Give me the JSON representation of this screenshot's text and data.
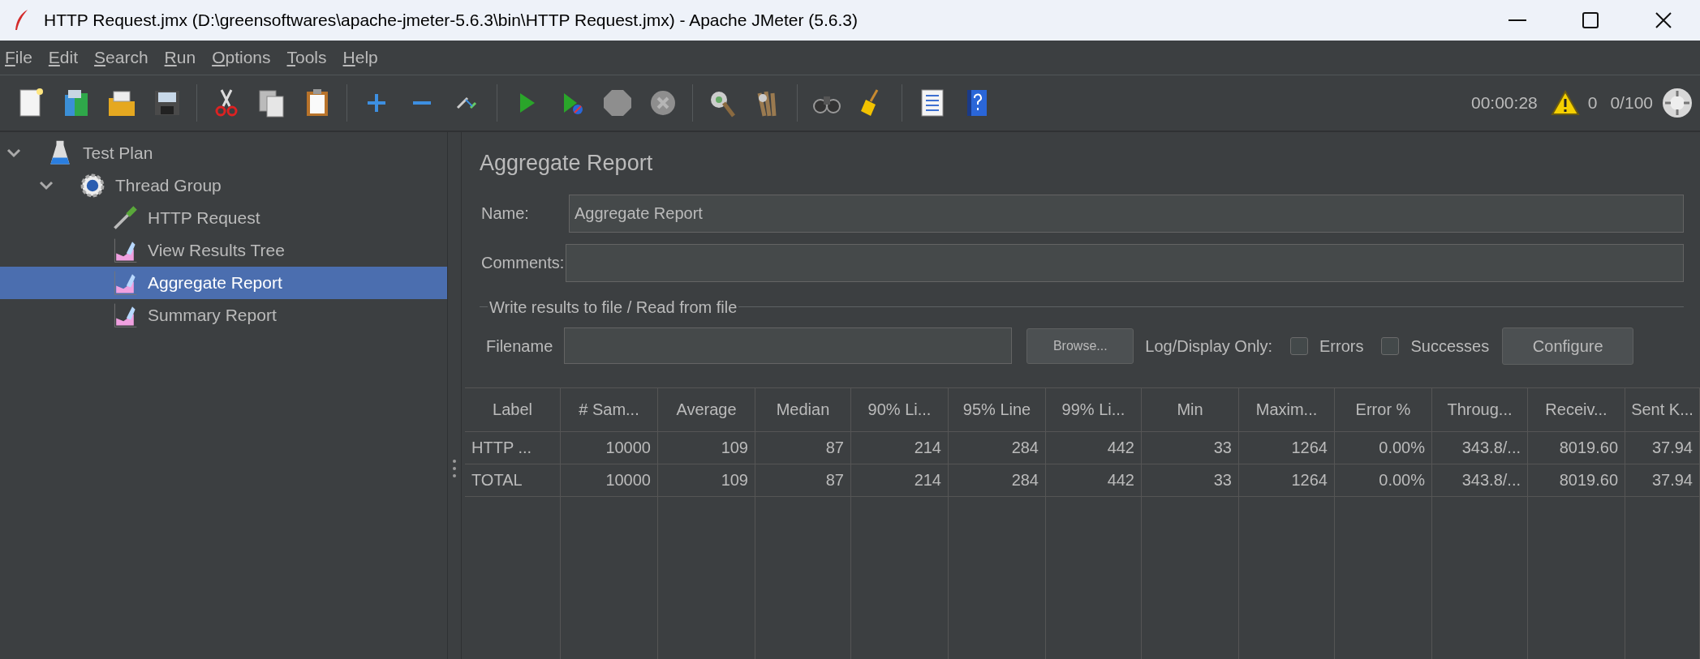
{
  "window": {
    "title": "HTTP Request.jmx (D:\\greensoftwares\\apache-jmeter-5.6.3\\bin\\HTTP Request.jmx) - Apache JMeter (5.6.3)"
  },
  "menu": [
    "File",
    "Edit",
    "Search",
    "Run",
    "Options",
    "Tools",
    "Help"
  ],
  "status": {
    "timer": "00:00:28",
    "warnings": "0",
    "threads": "0/100"
  },
  "tree": [
    {
      "label": "Test Plan",
      "kind": "plan",
      "expanded": true,
      "selected": false,
      "children": [
        {
          "label": "Thread Group",
          "kind": "group",
          "expanded": true,
          "selected": false,
          "children": [
            {
              "label": "HTTP Request",
              "kind": "sampler",
              "selected": false
            },
            {
              "label": "View Results Tree",
              "kind": "listener",
              "selected": false
            },
            {
              "label": "Aggregate Report",
              "kind": "listener",
              "selected": true
            },
            {
              "label": "Summary Report",
              "kind": "listener",
              "selected": false
            }
          ]
        }
      ]
    }
  ],
  "form": {
    "title": "Aggregate Report",
    "name_label": "Name:",
    "name_value": "Aggregate Report",
    "comments_label": "Comments:",
    "section": "Write results to file / Read from file",
    "filename_label": "Filename",
    "browse": "Browse...",
    "log_label": "Log/Display Only:",
    "checkboxes": [
      {
        "label": "Errors",
        "checked": false
      },
      {
        "label": "Successes",
        "checked": false
      }
    ],
    "configure": "Configure"
  },
  "table": {
    "columns": [
      "Label",
      "# Sam...",
      "Average",
      "Median",
      "90% Li...",
      "95% Line",
      "99% Li...",
      "Min",
      "Maxim...",
      "Error %",
      "Throug...",
      "Receiv...",
      "Sent K..."
    ],
    "rows": [
      [
        "HTTP ...",
        "10000",
        "109",
        "87",
        "214",
        "284",
        "442",
        "33",
        "1264",
        "0.00%",
        "343.8/...",
        "8019.60",
        "37.94"
      ],
      [
        "TOTAL",
        "10000",
        "109",
        "87",
        "214",
        "284",
        "442",
        "33",
        "1264",
        "0.00%",
        "343.8/...",
        "8019.60",
        "37.94"
      ]
    ]
  }
}
